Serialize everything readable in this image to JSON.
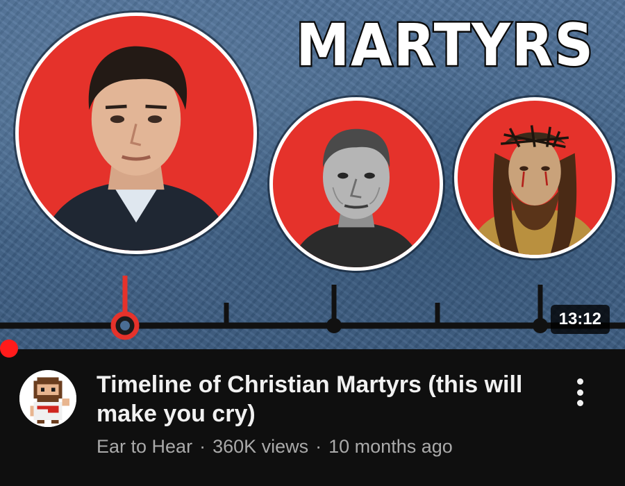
{
  "thumbnail": {
    "title_text": "MARTYRS",
    "duration": "13:12",
    "accent_color": "#e5322b",
    "background_color": "#4a6d93",
    "timeline_color": "#111111",
    "marker_color": "#e5322b"
  },
  "video": {
    "title": "Timeline of Christian Martyrs (this will make you cry)",
    "channel": "Ear to Hear",
    "views": "360K views",
    "age": "10 months ago",
    "separator": "·"
  },
  "icons": {
    "menu": "more-vert-icon",
    "avatar": "pixel-character-avatar"
  },
  "progress": {
    "watched_fraction": 0
  }
}
